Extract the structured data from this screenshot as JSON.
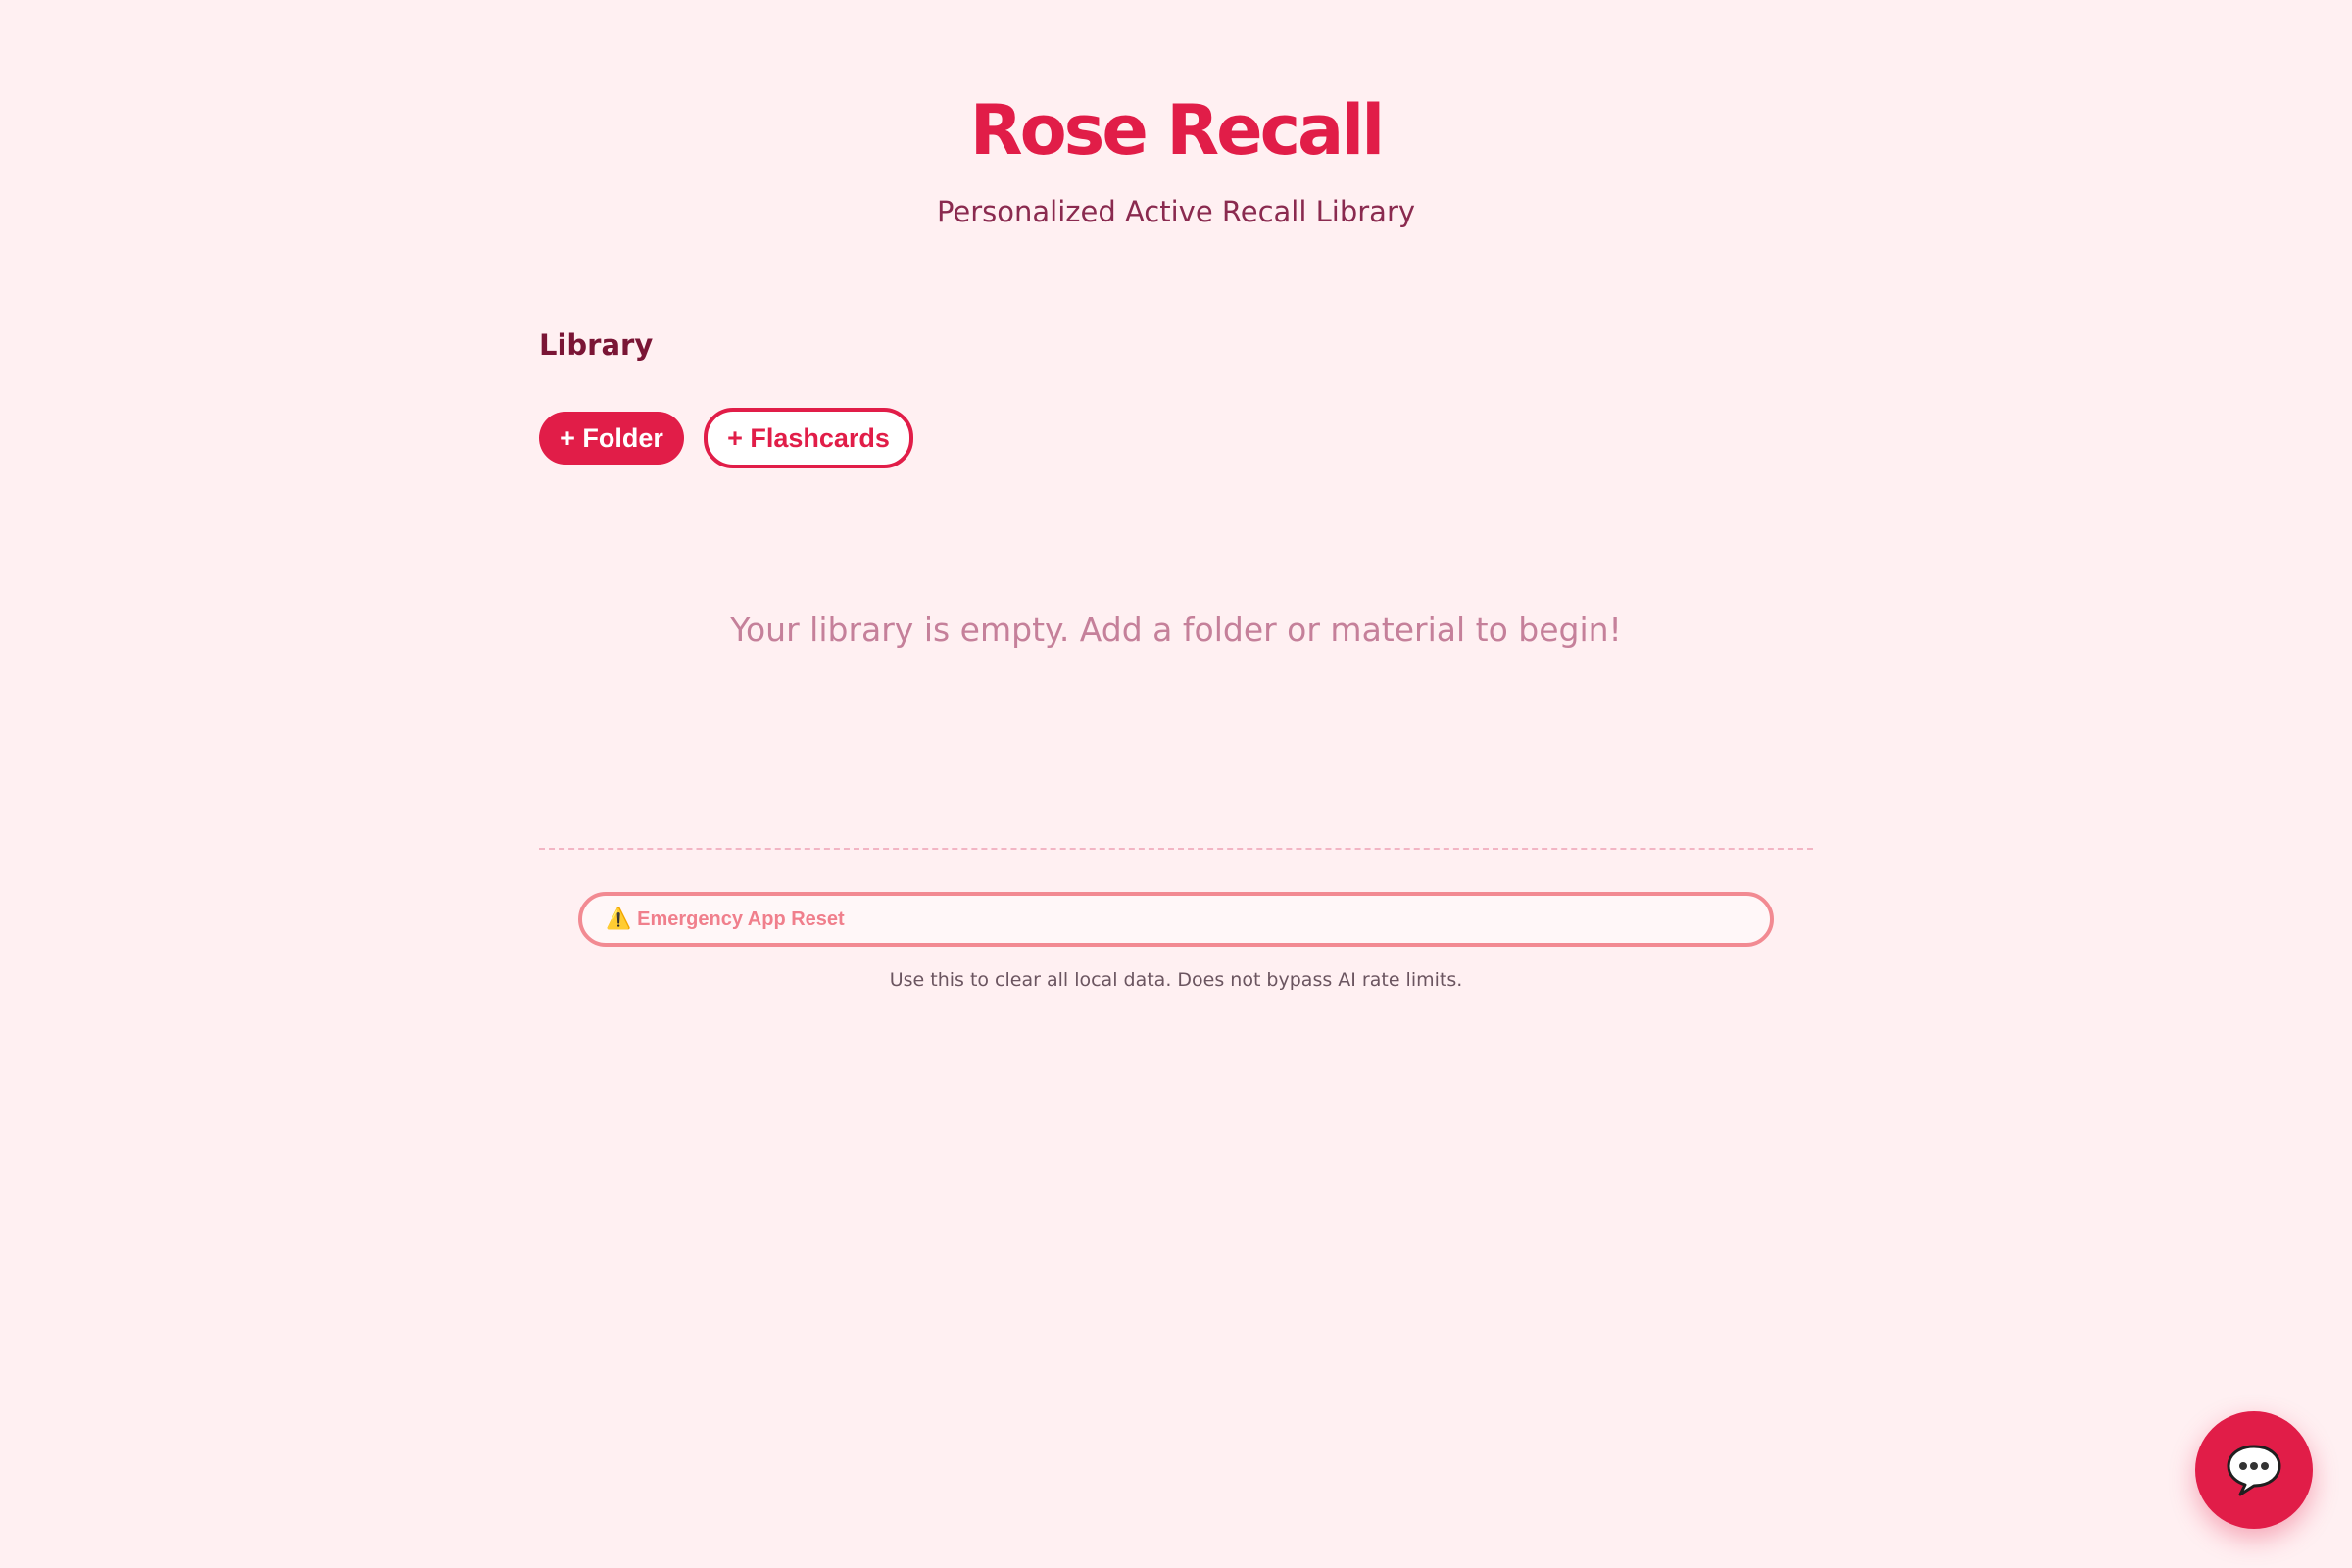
{
  "header": {
    "title": "Rose Recall",
    "subtitle": "Personalized Active Recall Library"
  },
  "library": {
    "heading": "Library",
    "add_folder_label": "+ Folder",
    "add_flashcards_label": "+ Flashcards",
    "empty_message": "Your library is empty. Add a folder or material to begin!"
  },
  "reset": {
    "icon": "warning-icon",
    "warning_glyph": "⚠️",
    "label": "Emergency App Reset",
    "note": "Use this to clear all local data. Does not bypass AI rate limits."
  },
  "chat": {
    "icon": "chat-bubble-icon"
  },
  "colors": {
    "accent": "#e11d48",
    "background": "#fff0f2",
    "reset_border": "#f28a92"
  }
}
